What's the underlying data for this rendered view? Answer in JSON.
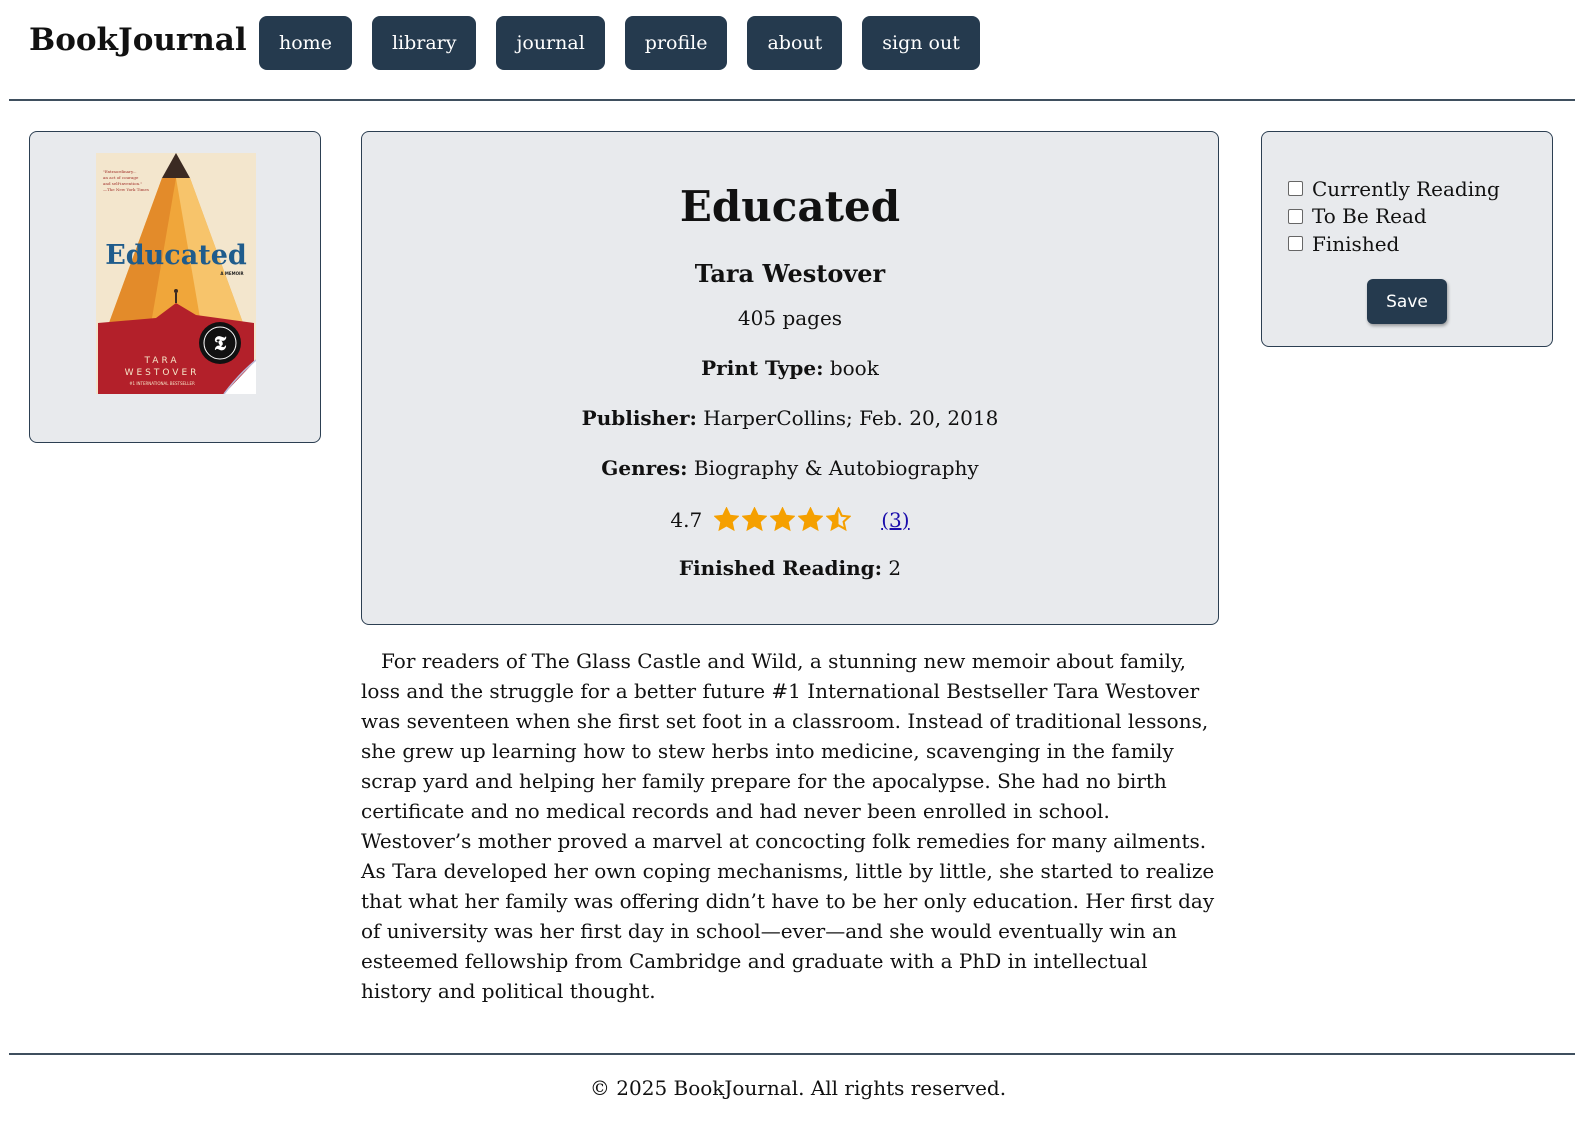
{
  "brand": "BookJournal",
  "nav": [
    "home",
    "library",
    "journal",
    "profile",
    "about",
    "sign out"
  ],
  "cover": {
    "quote": "\"Extraordinary... an act of courage and self-invention.\" —The New York Times",
    "title": "Educated",
    "subtitle": "A MEMOIR",
    "author_first": "TARA",
    "author_last": "WESTOVER",
    "tagline": "#1 INTERNATIONAL BESTSELLER"
  },
  "book": {
    "title": "Educated",
    "author": "Tara Westover",
    "pages": "405 pages",
    "print_type_label": "Print Type:",
    "print_type": "book",
    "publisher_label": "Publisher:",
    "publisher": "HarperCollins; Feb. 20, 2018",
    "genres_label": "Genres:",
    "genres": "Biography & Autobiography",
    "rating": "4.7",
    "rating_value": 4.7,
    "rating_count": "(3)",
    "finished_label": "Finished Reading:",
    "finished": "2"
  },
  "status": {
    "options": [
      "Currently Reading",
      "To Be Read",
      "Finished"
    ],
    "save_label": "Save"
  },
  "description": "For readers of The Glass Castle and Wild, a stunning new memoir about family, loss and the struggle for a better future #1 International Bestseller Tara Westover was seventeen when she first set foot in a classroom. Instead of traditional lessons, she grew up learning how to stew herbs into medicine, scavenging in the family scrap yard and helping her family prepare for the apocalypse. She had no birth certificate and no medical records and had never been enrolled in school. Westover’s mother proved a marvel at concocting folk remedies for many ailments. As Tara developed her own coping mechanisms, little by little, she started to realize that what her family was offering didn’t have to be her only education. Her first day of university was her first day in school—ever—and she would eventually win an esteemed fellowship from Cambridge and graduate with a PhD in intellectual history and political thought.",
  "footer": "© 2025 BookJournal. All rights reserved.",
  "colors": {
    "accent": "#253a4e",
    "panel": "#e8eaed",
    "star": "#f5a000",
    "link": "#1a0dab"
  }
}
